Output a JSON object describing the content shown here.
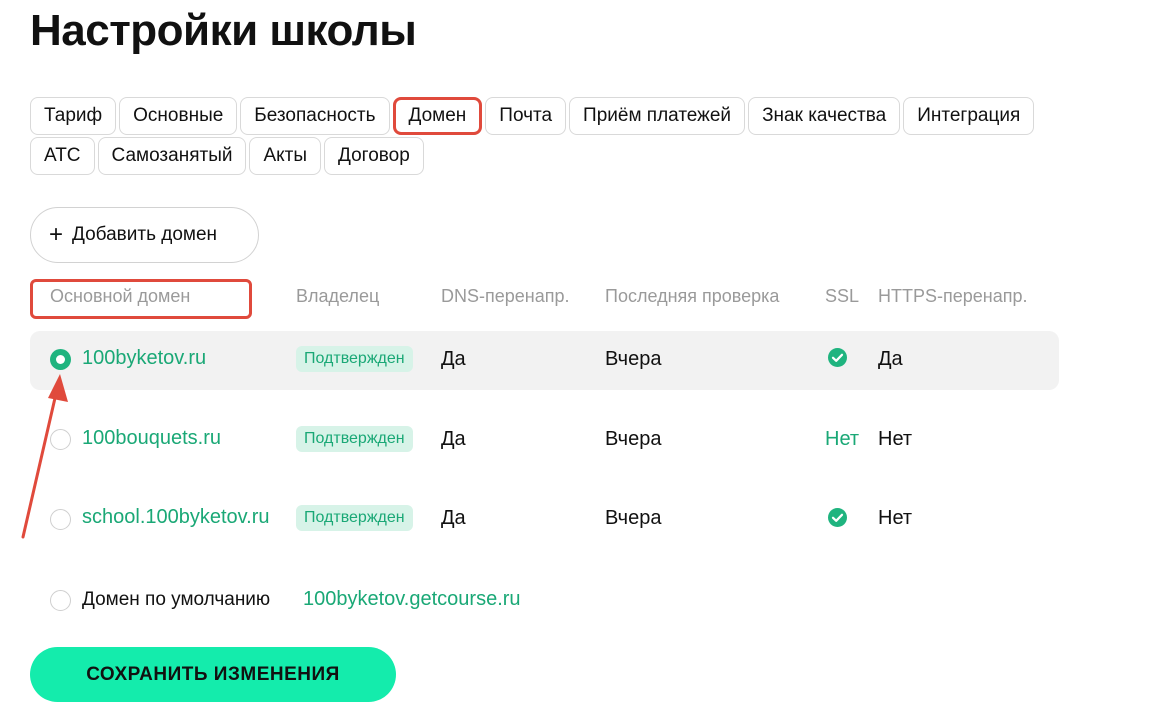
{
  "page": {
    "title": "Настройки школы"
  },
  "tabs": {
    "row1": [
      "Тариф",
      "Основные",
      "Безопасность",
      "Домен",
      "Почта",
      "Приём платежей",
      "Знак качества",
      "Интеграция"
    ],
    "row2": [
      "АТС",
      "Самозанятый",
      "Акты",
      "Договор"
    ],
    "active": "Домен"
  },
  "add_domain": {
    "label": "Добавить домен",
    "icon": "plus-icon"
  },
  "table": {
    "headers": {
      "primary": "Основной домен",
      "owner": "Владелец",
      "dns": "DNS-перенапр.",
      "last_check": "Последняя проверка",
      "ssl": "SSL",
      "https": "HTTPS-перенапр."
    },
    "rows": [
      {
        "domain": "100byketov.ru",
        "owner": "Подтвержден",
        "dns": "Да",
        "last_check": "Вчера",
        "ssl": "check-icon",
        "ssl_text": "",
        "https": "Да",
        "selected": true
      },
      {
        "domain": "100bouquets.ru",
        "owner": "Подтвержден",
        "dns": "Да",
        "last_check": "Вчера",
        "ssl": "",
        "ssl_text": "Нет",
        "https": "Нет",
        "selected": false
      },
      {
        "domain": "school.100byketov.ru",
        "owner": "Подтвержден",
        "dns": "Да",
        "last_check": "Вчера",
        "ssl": "check-icon",
        "ssl_text": "",
        "https": "Нет",
        "selected": false
      }
    ]
  },
  "default_domain": {
    "label": "Домен по умолчанию",
    "value": "100byketov.getcourse.ru",
    "selected": false
  },
  "save": {
    "label": "СОХРАНИТЬ ИЗМЕНЕНИЯ"
  },
  "colors": {
    "accent": "#1aa876",
    "save_button": "#14ecac",
    "highlight": "#e04a3c",
    "badge_bg": "#d7f3e8"
  }
}
